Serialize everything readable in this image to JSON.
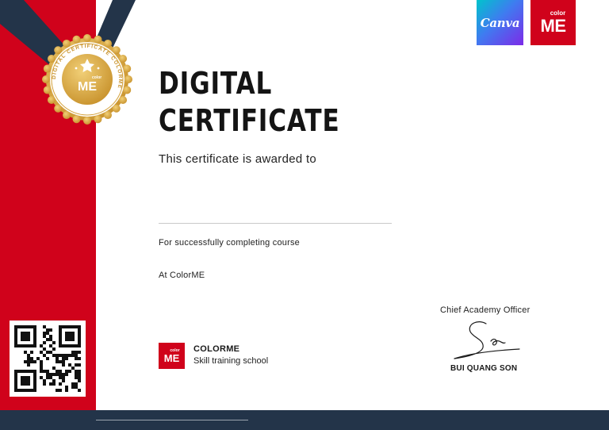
{
  "certificate": {
    "title_line1": "DIGITAL",
    "title_line2": "CERTIFICATE",
    "awarded_text": "This certificate is awarded to",
    "completing_text": "For successfully completing course",
    "location_text": "At ColorME"
  },
  "seal": {
    "ring_text": "DIGITAL CERTIFICATE COLORME",
    "brand_small": "color",
    "brand_big": "ME"
  },
  "logos": {
    "canva": "Canva",
    "colorme_small": "color",
    "colorme_big": "ME"
  },
  "school": {
    "logo_small": "color",
    "logo_big": "ME",
    "name": "COLORME",
    "tagline": "Skill training school"
  },
  "signatory": {
    "title": "Chief Academy Officer",
    "name": "BUI QUANG SON"
  },
  "colors": {
    "brand_red": "#d0021b",
    "navy": "#233449",
    "gold": "#d4a13a"
  }
}
